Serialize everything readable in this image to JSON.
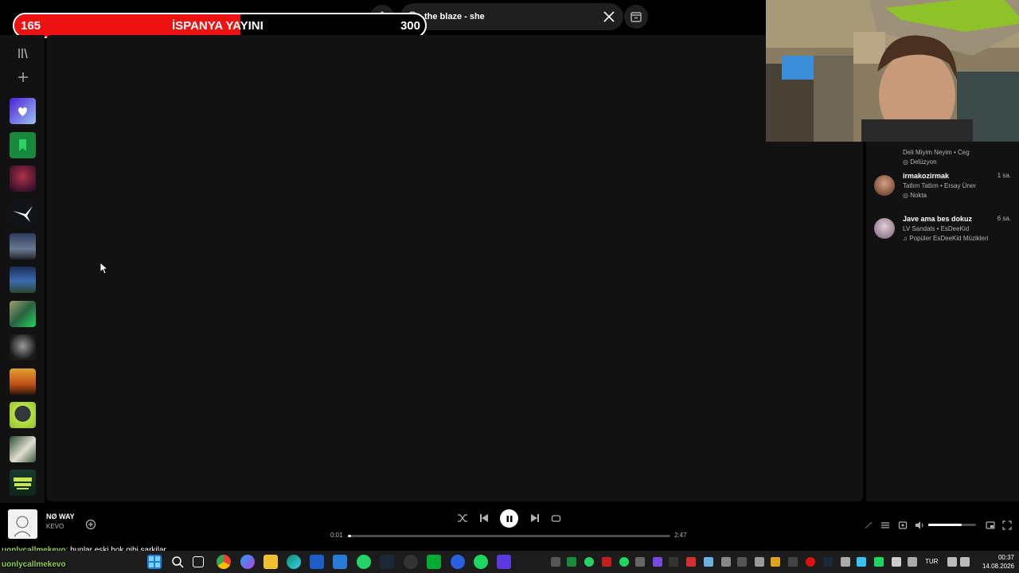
{
  "overlay": {
    "left_count": "165",
    "title": "İSPANYA YAYINI",
    "right_count": "300",
    "progress": 0.55
  },
  "search": {
    "value": "the blaze - she"
  },
  "friends": [
    {
      "name": "",
      "time": "",
      "track": "Deli Miyim Neyim • Ceg",
      "context": "Delüzyon"
    },
    {
      "name": "irmakozirmak",
      "time": "1 sa.",
      "track": "Tatlım Tatlım • Ersay Üner",
      "context": "Nokta"
    },
    {
      "name": "Jave ama bes dokuz",
      "time": "6 sa.",
      "track": "LV Sandals • EsDeeKid",
      "context": "Popüler EsDeeKid Müzikleri"
    }
  ],
  "player": {
    "title": "NØ WAY",
    "artist": "KEVO",
    "elapsed": "0:01",
    "duration": "2:47",
    "progress": 0.01,
    "volume": 0.7
  },
  "chat": [
    {
      "user": "uonlycallmekevo",
      "message": ": bunlar eski bok gibi sarkilar"
    },
    {
      "user": "uonlycallmekevo",
      "message": ""
    }
  ],
  "taskbar": {
    "lang": "TUR",
    "time": "00:37",
    "date": "14.08.2026"
  },
  "colors": {
    "accent": "#1ed760",
    "overlay_red": "#e11111",
    "panel": "#121212"
  }
}
